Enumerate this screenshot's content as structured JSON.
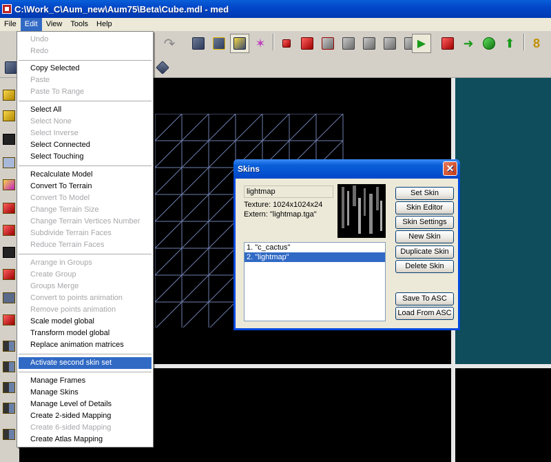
{
  "window": {
    "title": "C:\\Work_C\\Aum_new\\Aum75\\Beta\\Cube.mdl - med"
  },
  "menubar": [
    {
      "label": "File"
    },
    {
      "label": "Edit"
    },
    {
      "label": "View"
    },
    {
      "label": "Tools"
    },
    {
      "label": "Help"
    }
  ],
  "edit_menu": [
    {
      "label": "Undo",
      "enabled": false
    },
    {
      "label": "Redo",
      "enabled": false
    },
    {
      "label": "Copy Selected",
      "enabled": true
    },
    {
      "label": "Paste",
      "enabled": false
    },
    {
      "label": "Paste To Range",
      "enabled": false
    },
    {
      "label": "Select All",
      "enabled": true
    },
    {
      "label": "Select None",
      "enabled": false
    },
    {
      "label": "Select Inverse",
      "enabled": false
    },
    {
      "label": "Select Connected",
      "enabled": true
    },
    {
      "label": "Select Touching",
      "enabled": true
    },
    {
      "label": "Recalculate Model",
      "enabled": true
    },
    {
      "label": "Convert To Terrain",
      "enabled": true
    },
    {
      "label": "Convert To Model",
      "enabled": false
    },
    {
      "label": "Change Terrain Size",
      "enabled": false
    },
    {
      "label": "Change Terrain Vertices Number",
      "enabled": false
    },
    {
      "label": "Subdivide Terrain Faces",
      "enabled": false
    },
    {
      "label": "Reduce Terrain Faces",
      "enabled": false
    },
    {
      "label": "Arrange in Groups",
      "enabled": false
    },
    {
      "label": "Create Group",
      "enabled": false
    },
    {
      "label": "Groups Merge",
      "enabled": false
    },
    {
      "label": "Convert to points animation",
      "enabled": false
    },
    {
      "label": "Remove points animation",
      "enabled": false
    },
    {
      "label": "Scale model global",
      "enabled": true
    },
    {
      "label": "Transform model global",
      "enabled": true
    },
    {
      "label": "Replace animation matrices",
      "enabled": true
    },
    {
      "label": "Activate second skin set",
      "enabled": true,
      "highlighted": true
    },
    {
      "label": "Manage Frames",
      "enabled": true
    },
    {
      "label": "Manage Skins",
      "enabled": true
    },
    {
      "label": "Manage Level of Details",
      "enabled": true
    },
    {
      "label": "Create 2-sided Mapping",
      "enabled": true
    },
    {
      "label": "Create 6-sided Mapping",
      "enabled": false
    },
    {
      "label": "Create Atlas Mapping",
      "enabled": true
    }
  ],
  "skins_dialog": {
    "title": "Skins",
    "close_glyph": "✕",
    "skin_name": "lightmap",
    "texture_info": "Texture: 1024x1024x24",
    "extern_info": "Extern: \"lightmap.tga\"",
    "skins": [
      {
        "label": "1. \"c_cactus\"",
        "selected": false
      },
      {
        "label": "2. \"lightmap\"",
        "selected": true
      }
    ],
    "buttons": {
      "set_skin": "Set Skin",
      "skin_editor": "Skin Editor",
      "skin_settings": "Skin Settings",
      "new_skin": "New Skin",
      "duplicate_skin": "Duplicate Skin",
      "delete_skin": "Delete Skin",
      "save_to_asc": "Save To ASC",
      "load_from_asc": "Load From ASC"
    }
  },
  "colors": {
    "titlebar": "#0247c9",
    "selection": "#316ac5",
    "viewport_bg": "#000000",
    "viewport_teal": "#0f4c5c",
    "mesh_lines": "#6f7fb0"
  }
}
